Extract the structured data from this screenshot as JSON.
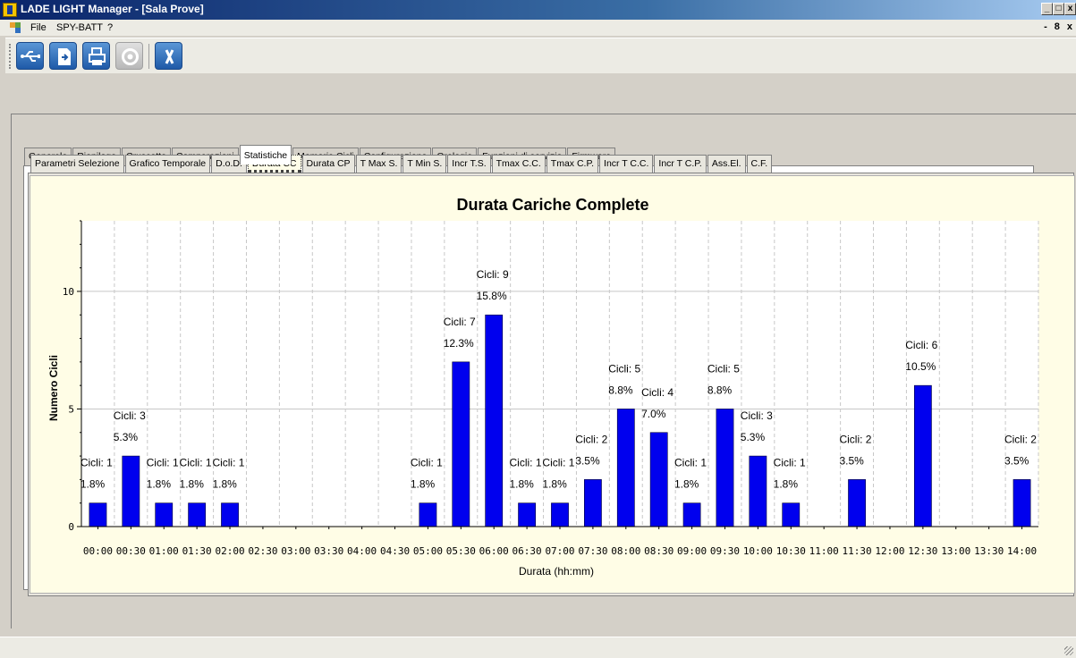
{
  "window": {
    "title": "LADE LIGHT Manager - [Sala Prove]",
    "controls": [
      "_",
      "□",
      "x"
    ],
    "mdi_controls": [
      "-",
      "8",
      "x"
    ]
  },
  "menu": {
    "items": [
      "File",
      "SPY-BATT",
      "?"
    ]
  },
  "toolbar": {
    "buttons": [
      "usb-icon",
      "export-icon",
      "print-icon",
      "disabled-icon",
      "close-x-icon"
    ]
  },
  "tabs": {
    "main": [
      "Generale",
      "Riepilogo",
      "Cruscotto",
      "Comparazioni",
      "Statistiche",
      "Memoria Cicli",
      "Configurazione",
      "Orologio",
      "Funzioni di servizio",
      "Firmware"
    ],
    "main_active": "Statistiche",
    "sub": [
      "Parametri Selezione",
      "Grafico Temporale",
      "D.o.D.",
      "Durata CC",
      "Durata CP",
      "T Max S.",
      "T Min S.",
      "Incr T.S.",
      "Tmax C.C.",
      "Tmax C.P.",
      "Incr T C.C.",
      "Incr T C.P.",
      "Ass.El.",
      "C.F."
    ],
    "sub_active": "Durata CC"
  },
  "chart_data": {
    "type": "bar",
    "title": "Durata Cariche Complete",
    "xlabel": "Durata (hh:mm)",
    "ylabel": "Numero Cicli",
    "ylim": [
      0,
      13
    ],
    "yticks": [
      0,
      5,
      10
    ],
    "categories": [
      "00:00",
      "00:30",
      "01:00",
      "01:30",
      "02:00",
      "02:30",
      "03:00",
      "03:30",
      "04:00",
      "04:30",
      "05:00",
      "05:30",
      "06:00",
      "06:30",
      "07:00",
      "07:30",
      "08:00",
      "08:30",
      "09:00",
      "09:30",
      "10:00",
      "10:30",
      "11:00",
      "11:30",
      "12:00",
      "12:30",
      "13:00",
      "13:30",
      "14:00"
    ],
    "values": [
      1,
      3,
      1,
      1,
      1,
      0,
      0,
      0,
      0,
      0,
      1,
      7,
      9,
      1,
      1,
      2,
      5,
      4,
      1,
      5,
      3,
      1,
      0,
      2,
      0,
      6,
      0,
      0,
      2
    ],
    "count_labels": [
      "Cicli: 1",
      "Cicli: 3",
      "Cicli: 1",
      "Cicli: 1",
      "Cicli: 1",
      "",
      "",
      "",
      "",
      "",
      "Cicli: 1",
      "Cicli: 7",
      "Cicli: 9",
      "Cicli: 1",
      "Cicli: 1",
      "Cicli: 2",
      "Cicli: 5",
      "Cicli: 4",
      "Cicli: 1",
      "Cicli: 5",
      "Cicli: 3",
      "Cicli: 1",
      "",
      "Cicli: 2",
      "",
      "Cicli: 6",
      "",
      "",
      "Cicli: 2"
    ],
    "percent_labels": [
      "1.8%",
      "5.3%",
      "1.8%",
      "1.8%",
      "1.8%",
      "",
      "",
      "",
      "",
      "",
      "1.8%",
      "12.3%",
      "15.8%",
      "1.8%",
      "1.8%",
      "3.5%",
      "8.8%",
      "7.0%",
      "1.8%",
      "8.8%",
      "5.3%",
      "1.8%",
      "",
      "3.5%",
      "",
      "10.5%",
      "",
      "",
      "3.5%"
    ],
    "bar_color": "#0000ee",
    "background": "#fffde6",
    "grid": true,
    "legend": "none"
  }
}
